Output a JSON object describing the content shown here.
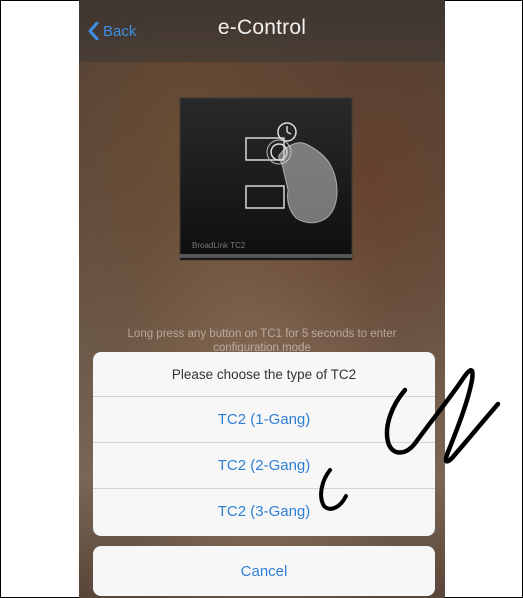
{
  "navbar": {
    "back_label": "Back",
    "title": "e-Control"
  },
  "device": {
    "brand_text": "BroadLink TC2"
  },
  "hint_text": "Long press any button on TC1 for 5 seconds to enter configuration mode",
  "sheet": {
    "title": "Please choose the type of TC2",
    "options": [
      {
        "label": "TC2 (1-Gang)"
      },
      {
        "label": "TC2 (2-Gang)"
      },
      {
        "label": "TC2 (3-Gang)"
      }
    ],
    "cancel_label": "Cancel"
  },
  "colors": {
    "accent": "#2f7fd6",
    "back_accent": "#3d8ee6",
    "sheet_bg": "#f7f7f7"
  }
}
